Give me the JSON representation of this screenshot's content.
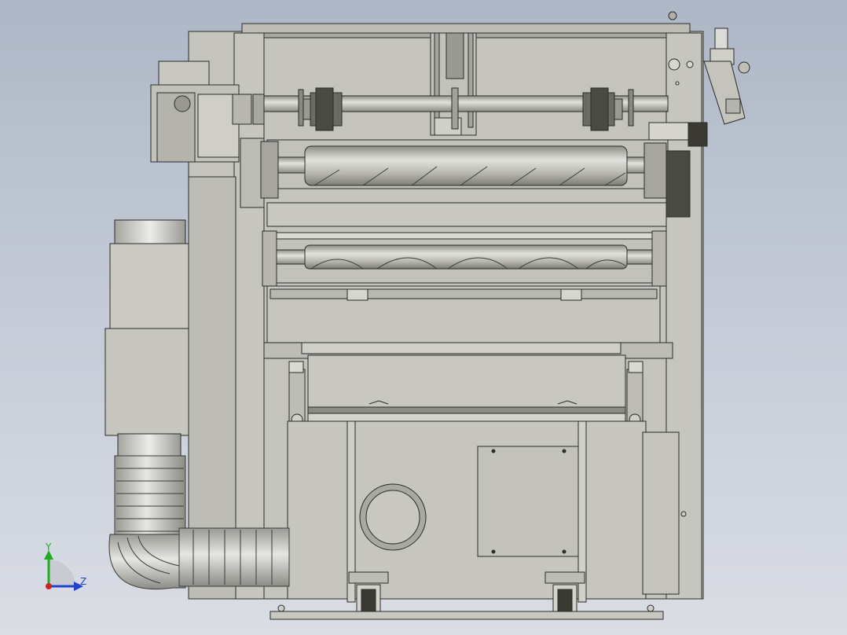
{
  "viewport": {
    "background_top": "#aeb7c6",
    "background_bottom": "#dadde4"
  },
  "model": {
    "body_color": "#c9c9c1",
    "shade_color": "#b4b4ac",
    "roller_color": "#bdbdb5",
    "outline_color": "#2a2a2a",
    "dark_color": "#3a3a3a",
    "duct_color": "#d2d2cc"
  },
  "triad": {
    "y_label": "Y",
    "z_label": "Z",
    "y_color": "#22aa22",
    "z_color": "#2244cc",
    "x_color": "#cc2222"
  }
}
